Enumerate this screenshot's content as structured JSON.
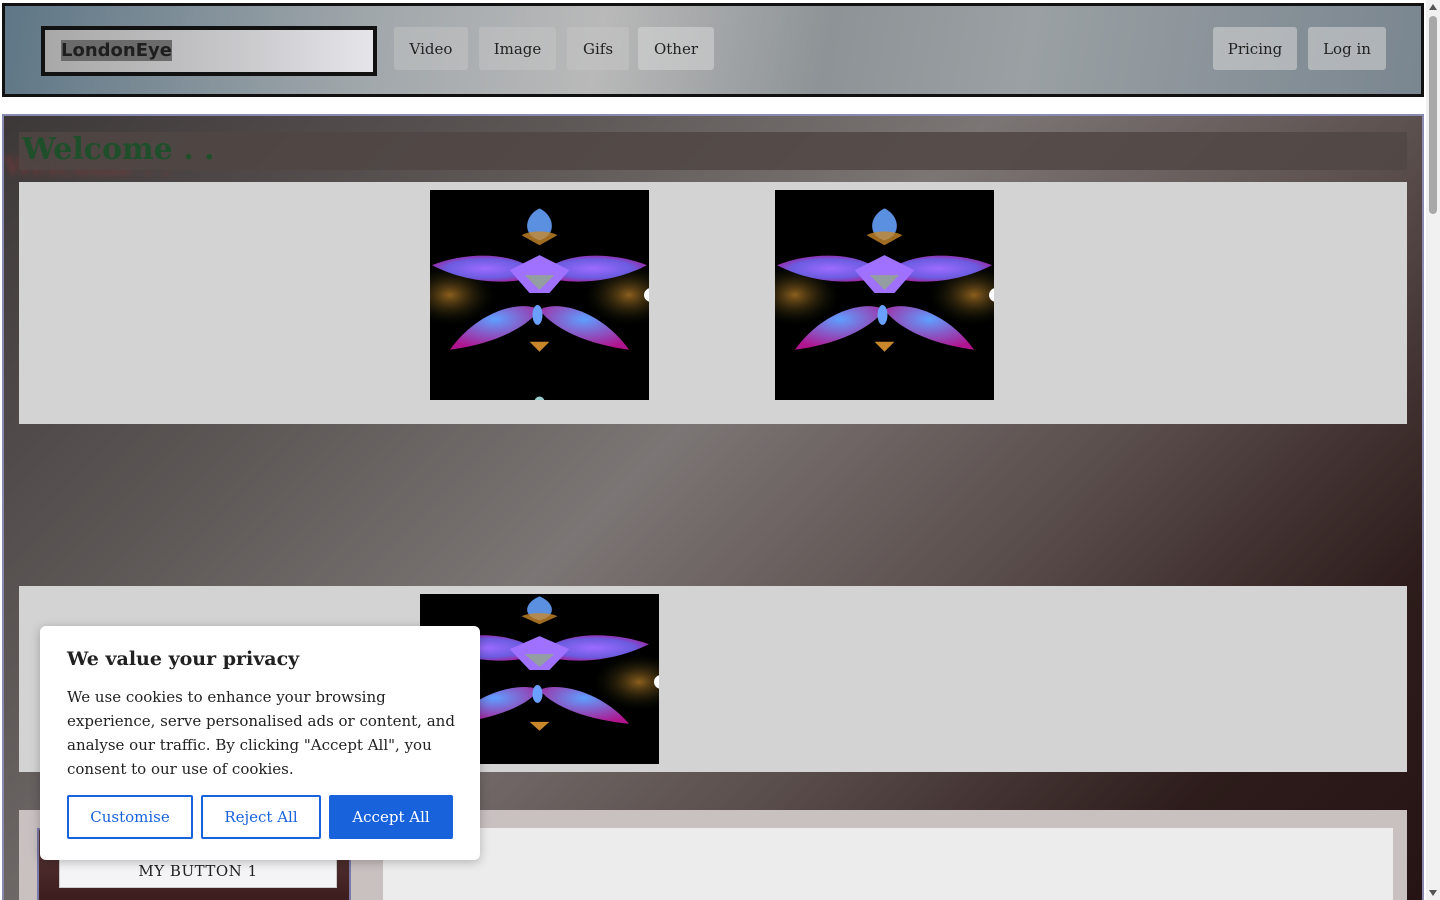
{
  "header": {
    "search_value": "LondonEye",
    "nav_left": [
      "Video",
      "Image",
      "Gifs",
      "Other"
    ],
    "nav_right": [
      "Pricing",
      "Log in"
    ]
  },
  "main": {
    "welcome": "Welcome . .",
    "bottom_button": "MY BUTTON 1"
  },
  "cookie": {
    "title": "We value your privacy",
    "text": "We use cookies to enhance your browsing experience, serve personalised ads or content, and analyse our traffic. By clicking \"Accept All\", you consent to our use of cookies.",
    "customise": "Customise",
    "reject": "Reject All",
    "accept": "Accept All"
  },
  "colors": {
    "cookie_accent": "#1863dc",
    "welcome_text": "#1f4f2a",
    "gallery_bg": "#d3d3d3"
  },
  "icons": {
    "thumbnail": "abstract-flower-image"
  }
}
